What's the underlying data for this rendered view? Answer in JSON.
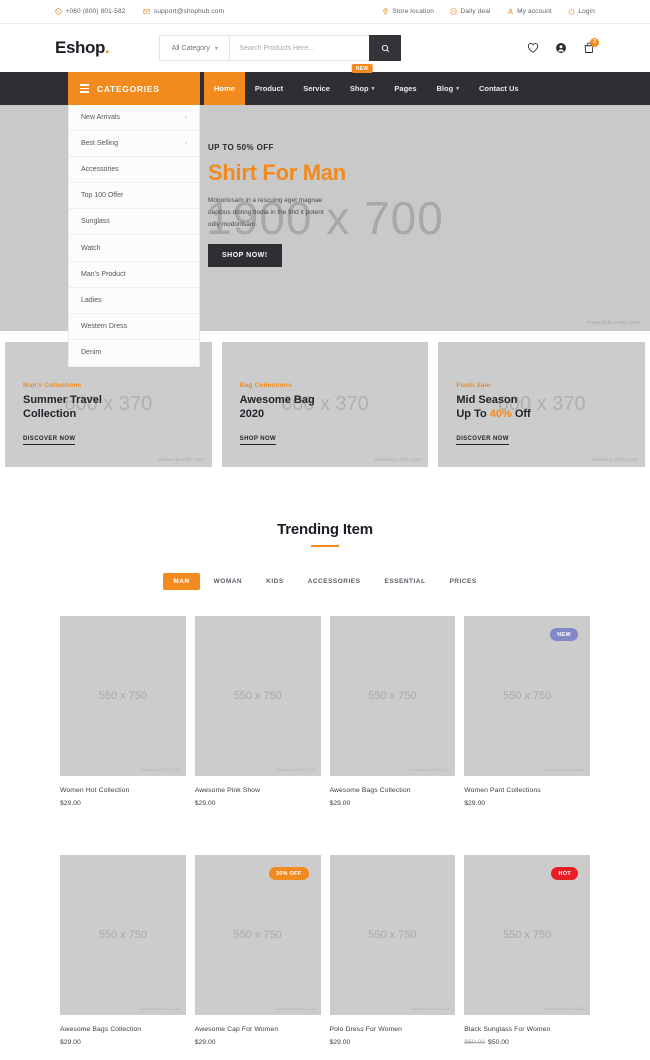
{
  "colors": {
    "accent": "#f28a1d",
    "dark": "#2e2e33",
    "badge_new": "#8287c8",
    "badge_sale": "#f28a1d",
    "badge_hot": "#ea1d25"
  },
  "topbar": {
    "phone": "+060 (800) 801-582",
    "email": "support@shophub.com",
    "links": [
      {
        "label": "Store location",
        "icon": "location-pin-icon"
      },
      {
        "label": "Daily deal",
        "icon": "tag-icon"
      },
      {
        "label": "My account",
        "icon": "user-icon"
      },
      {
        "label": "Login",
        "icon": "power-icon"
      }
    ]
  },
  "header": {
    "logo": "Eshop",
    "logo_dot": ".",
    "category_select": "All Category",
    "search_placeholder": "Search Products Here...",
    "search_value": "",
    "cart_count": "2"
  },
  "nav": {
    "categories_label": "CATEGORIES",
    "links": [
      {
        "label": "Home",
        "active": true,
        "caret": false,
        "badge": ""
      },
      {
        "label": "Product",
        "active": false,
        "caret": false,
        "badge": ""
      },
      {
        "label": "Service",
        "active": false,
        "caret": false,
        "badge": ""
      },
      {
        "label": "Shop",
        "active": false,
        "caret": true,
        "badge": "NEW"
      },
      {
        "label": "Pages",
        "active": false,
        "caret": false,
        "badge": ""
      },
      {
        "label": "Blog",
        "active": false,
        "caret": true,
        "badge": ""
      },
      {
        "label": "Contact Us",
        "active": false,
        "caret": false,
        "badge": ""
      }
    ]
  },
  "category_menu": [
    {
      "label": "New Arrivals",
      "arrow": "›"
    },
    {
      "label": "Best Selling",
      "arrow": "›"
    },
    {
      "label": "Accessories",
      "arrow": ""
    },
    {
      "label": "Top 100 Offer",
      "arrow": ""
    },
    {
      "label": "Sunglass",
      "arrow": ""
    },
    {
      "label": "Watch",
      "arrow": ""
    },
    {
      "label": "Man's Product",
      "arrow": ""
    },
    {
      "label": "Ladies",
      "arrow": ""
    },
    {
      "label": "Western Dress",
      "arrow": ""
    },
    {
      "label": "Denim",
      "arrow": ""
    }
  ],
  "hero": {
    "kicker": "UP TO 50% OFF",
    "title": "Shirt For Man",
    "description": "Moborlosam in a rescuing eget magnae dapibus disting tlodia in the find it potent odiy modonisam.",
    "cta": "SHOP NOW!",
    "placeholder": "1900 x 700",
    "powered": "Powered by HTML.COM"
  },
  "promos": [
    {
      "kicker": "Man's Collections",
      "title_a": "Summer Travel",
      "title_b": "Collection",
      "highlight": "",
      "link": "DISCOVER NOW",
      "placeholder": "600 x 370",
      "powered": "Powered by HTML.COM"
    },
    {
      "kicker": "Bag Collections",
      "title_a": "Awesome Bag",
      "title_b": "2020",
      "highlight": "",
      "link": "SHOP NOW",
      "placeholder": "600 x 370",
      "powered": "Powered by HTML.COM"
    },
    {
      "kicker": "Flash Sale",
      "title_a": "Mid Season",
      "title_b": "Up To ",
      "highlight": "40%",
      "title_c": " Off",
      "link": "DISCOVER NOW",
      "placeholder": "600 x 370",
      "powered": "Powered by HTML.COM"
    }
  ],
  "trending": {
    "title": "Trending Item",
    "tabs": [
      {
        "label": "MAN",
        "active": true
      },
      {
        "label": "WOMAN",
        "active": false
      },
      {
        "label": "KIDS",
        "active": false
      },
      {
        "label": "ACCESSORIES",
        "active": false
      },
      {
        "label": "ESSENTIAL",
        "active": false
      },
      {
        "label": "PRICES",
        "active": false
      }
    ]
  },
  "products_row1": [
    {
      "name": "Women Hot Collection",
      "price": "$29.00",
      "old_price": "",
      "badge": "",
      "badge_type": "",
      "placeholder": "550 x 750",
      "powered": "Powered by HTML.COM"
    },
    {
      "name": "Awesome Pink Show",
      "price": "$29.00",
      "old_price": "",
      "badge": "",
      "badge_type": "",
      "placeholder": "550 x 750",
      "powered": "Powered by HTML.COM"
    },
    {
      "name": "Awesome Bags Collection",
      "price": "$29.00",
      "old_price": "",
      "badge": "",
      "badge_type": "",
      "placeholder": "550 x 750",
      "powered": "Powered by HTML.COM"
    },
    {
      "name": "Women Pant Collections",
      "price": "$29.00",
      "old_price": "",
      "badge": "NEW",
      "badge_type": "new",
      "placeholder": "550 x 750",
      "powered": "Powered by HTML.COM"
    }
  ],
  "products_row2": [
    {
      "name": "Awesome Bags Collection",
      "price": "$29.00",
      "old_price": "",
      "badge": "",
      "badge_type": "",
      "placeholder": "550 x 750",
      "powered": "Powered by HTML.COM"
    },
    {
      "name": "Awesome Cap For Women",
      "price": "$29.00",
      "old_price": "",
      "badge": "30% OFF",
      "badge_type": "sale",
      "placeholder": "550 x 750",
      "powered": "Powered by HTML.COM"
    },
    {
      "name": "Polo Dress For Women",
      "price": "$29.00",
      "old_price": "",
      "badge": "",
      "badge_type": "",
      "placeholder": "550 x 750",
      "powered": "Powered by HTML.COM"
    },
    {
      "name": "Black Sunglass For Women",
      "price": "$50.00",
      "old_price": "$60.00",
      "badge": "HOT",
      "badge_type": "hot",
      "placeholder": "550 x 750",
      "powered": "Powered by HTML.COM"
    }
  ]
}
